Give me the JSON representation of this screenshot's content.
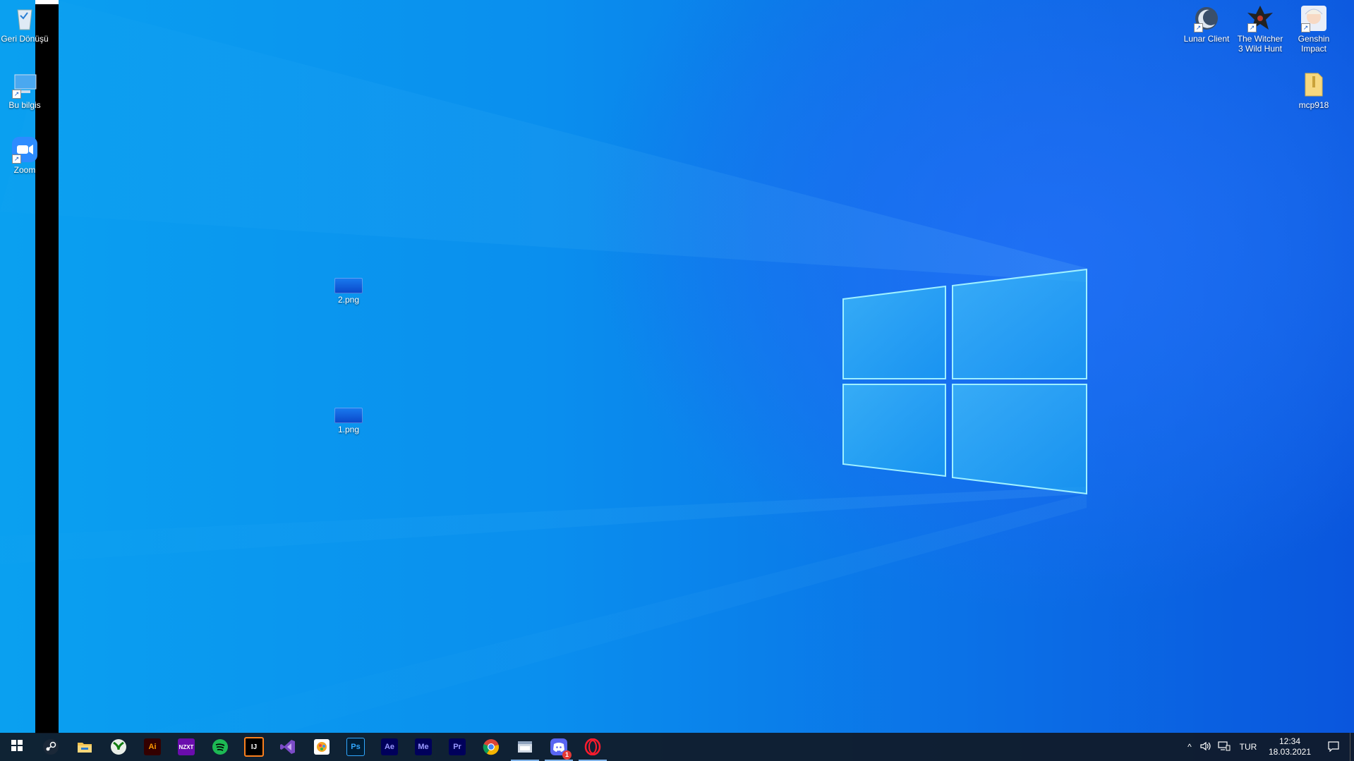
{
  "desktop": {
    "left_icons": [
      {
        "label": "Geri Dönüşü",
        "icon": "recycle-bin-icon"
      },
      {
        "label": "Bu bilgis",
        "icon": "this-pc-icon"
      },
      {
        "label": "Zoom",
        "icon": "zoom-icon"
      }
    ],
    "right_icons": [
      {
        "label": "Lunar Client",
        "icon": "lunar-client-icon"
      },
      {
        "label": "The Witcher 3 Wild Hunt",
        "icon": "witcher-icon"
      },
      {
        "label": "Genshin Impact",
        "icon": "genshin-icon"
      },
      {
        "label": "mcp918",
        "icon": "folder-zip-icon"
      }
    ],
    "files": [
      {
        "label": "2.png",
        "icon": "image-file-icon"
      },
      {
        "label": "1.png",
        "icon": "image-file-icon"
      }
    ]
  },
  "taskbar": {
    "apps": [
      {
        "name": "start",
        "icon": "windows-start-icon",
        "text": "",
        "color": "#ffffff"
      },
      {
        "name": "steam",
        "icon": "steam-icon",
        "text": "",
        "color": "#1b2838"
      },
      {
        "name": "file-explorer",
        "icon": "folder-icon",
        "text": "",
        "color": "#f2c14e"
      },
      {
        "name": "xbox",
        "icon": "xbox-icon",
        "text": "",
        "color": "#107c10"
      },
      {
        "name": "illustrator",
        "icon": "illustrator-icon",
        "text": "Ai",
        "color": "#330000"
      },
      {
        "name": "nzxt",
        "icon": "nzxt-icon",
        "text": "NZXT",
        "color": "#6a0dad"
      },
      {
        "name": "spotify",
        "icon": "spotify-icon",
        "text": "",
        "color": "#1db954"
      },
      {
        "name": "intellij",
        "icon": "intellij-icon",
        "text": "IJ",
        "color": "#000000"
      },
      {
        "name": "visual-studio",
        "icon": "visual-studio-icon",
        "text": "",
        "color": "#7b4cc7"
      },
      {
        "name": "paint",
        "icon": "paint-icon",
        "text": "",
        "color": "#ffffff"
      },
      {
        "name": "photoshop",
        "icon": "photoshop-icon",
        "text": "Ps",
        "color": "#001e36"
      },
      {
        "name": "after-effects",
        "icon": "after-effects-icon",
        "text": "Ae",
        "color": "#00005b"
      },
      {
        "name": "media-encoder",
        "icon": "media-encoder-icon",
        "text": "Me",
        "color": "#00005b"
      },
      {
        "name": "premiere",
        "icon": "premiere-icon",
        "text": "Pr",
        "color": "#00005b"
      },
      {
        "name": "chrome",
        "icon": "chrome-icon",
        "text": "",
        "color": "#ffffff"
      },
      {
        "name": "explorer-window",
        "icon": "window-explorer-icon",
        "text": "",
        "color": "#cfd8e3"
      },
      {
        "name": "discord",
        "icon": "discord-icon",
        "text": "",
        "color": "#5865f2",
        "badge": "1"
      },
      {
        "name": "opera",
        "icon": "opera-icon",
        "text": "",
        "color": "#ff1b2d"
      }
    ],
    "tray": {
      "chevron": "^",
      "language": "TUR",
      "time": "12:34",
      "date": "18.03.2021"
    }
  }
}
